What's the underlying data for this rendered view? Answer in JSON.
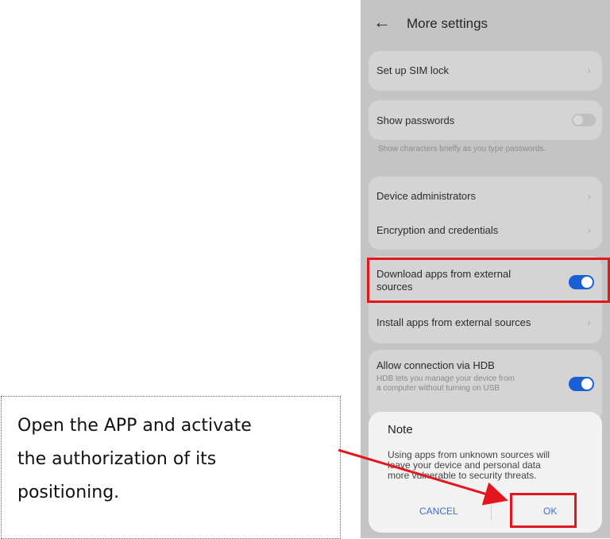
{
  "header": {
    "back_icon": "back-arrow-icon",
    "title": "More settings"
  },
  "settings": {
    "sim_lock": "Set up SIM lock",
    "show_passwords": "Show passwords",
    "show_passwords_desc": "Show characters briefly as you type passwords.",
    "device_admins": "Device administrators",
    "encryption": "Encryption and credentials",
    "download_apps_line1": "Download apps from external",
    "download_apps_line2": "sources",
    "install_apps": "Install apps from external sources",
    "hdb_title": "Allow connection via HDB",
    "hdb_desc_line1": "HDB lets you manage your device from",
    "hdb_desc_line2": "a computer without turning on USB"
  },
  "toggles": {
    "show_passwords": false,
    "download_apps": true,
    "hdb": true
  },
  "dialog": {
    "title": "Note",
    "body_line1": "Using apps from unknown sources will",
    "body_line2": "leave your device and personal data",
    "body_line3": "more vulnerable to security threats.",
    "cancel": "CANCEL",
    "ok": "OK"
  },
  "callout": {
    "line1": "Open the APP and activate",
    "line2": "the authorization of its",
    "line3": "positioning."
  },
  "colors": {
    "highlight": "#e3151d",
    "toggle_on": "#1a5fd6",
    "accent_text": "#3a6fd8"
  }
}
